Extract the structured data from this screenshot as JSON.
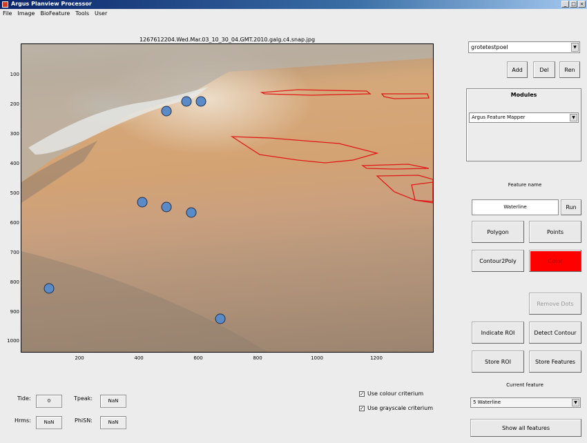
{
  "window": {
    "title": "Argus Planview Processor",
    "controls": [
      "_",
      "□",
      "×"
    ]
  },
  "menu": [
    "File",
    "Image",
    "BioFeature",
    "Tools",
    "User"
  ],
  "plot": {
    "title": "1267612204.Wed.Mar.03_10_30_04.GMT.2010.galg.c4.snap.jpg",
    "yticks": [
      "100",
      "200",
      "300",
      "400",
      "500",
      "600",
      "700",
      "800",
      "900",
      "1000"
    ],
    "xticks": [
      "200",
      "400",
      "600",
      "800",
      "1000",
      "1200"
    ],
    "marker_color": "#5b8bc7",
    "polygon_color": "#e01818"
  },
  "fields": {
    "tide_label": "Tide:",
    "tide_value": "0",
    "tpeak_label": "Tpeak:",
    "tpeak_value": "NaN",
    "hrms_label": "Hrms:",
    "hrms_value": "NaN",
    "phisn_label": "PhiSN:",
    "phisn_value": "NaN"
  },
  "checks": {
    "colour": {
      "label": "Use colour criterium",
      "checked": "✓"
    },
    "grayscale": {
      "label": "Use grayscale criterium",
      "checked": "✓"
    }
  },
  "right": {
    "user_select": "grotetestpoel",
    "add": "Add",
    "del": "Del",
    "ren": "Ren",
    "modules_title": "Modules",
    "module_select": "Argus Feature Mapper",
    "feature_name_label": "Feature name",
    "feature_name_value": "Waterline",
    "run": "Run",
    "polygon": "Polygon",
    "points": "Points",
    "contour2poly": "Contour2Poly",
    "color": "Color",
    "remove_dots": "Remove Dots",
    "indicate_roi": "Indicate ROI",
    "detect_contour": "Detect Contour",
    "store_roi": "Store ROI",
    "store_features": "Store Features",
    "current_feature_label": "Current feature",
    "current_feature_select": "5 Waterline",
    "show_all": "Show all features"
  }
}
